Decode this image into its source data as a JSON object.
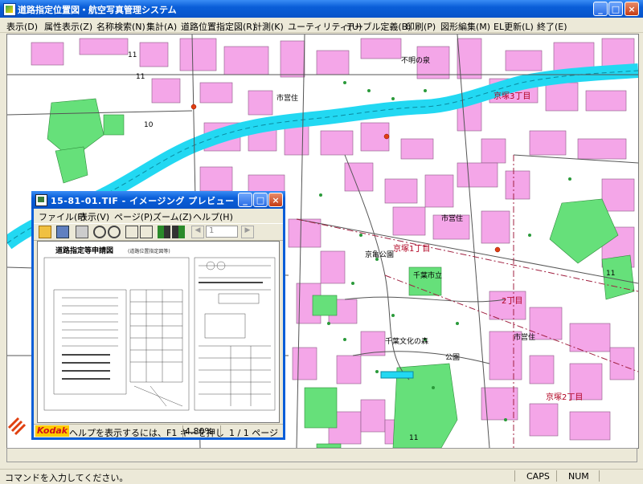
{
  "app": {
    "title": "道路指定位置図・航空写真管理システム",
    "window_buttons": {
      "minimize": "_",
      "maximize": "□",
      "close": "×"
    }
  },
  "menubar": [
    "表示(D)",
    "属性表示(Z)",
    "名称検索(N)",
    "集計(A)",
    "道路位置指定図(R)",
    "計測(K)",
    "ユーティリティ(U)",
    "テーブル定義(B)",
    "印刷(P)",
    "図形編集(M)",
    "EL更新(L)",
    "終了(E)"
  ],
  "map": {
    "labels": {
      "shiei1": "市営住",
      "shiei2": "市営住",
      "shiei3": "市営住",
      "kyouto": "京亀公園",
      "chiba_shiritsu": "千葉市立",
      "chiba_shiritsu2": "千葉文化の森",
      "kamimachi": "京塚1丁目",
      "kamimachi2": "京塚2丁目",
      "kamimachi3": "京塚3丁目",
      "machi2": "2丁目",
      "num_11a": "11",
      "num_11b": "11",
      "num_11c": "11",
      "num_11d": "11",
      "num_10": "10",
      "hoshi": "不明の泉",
      "kouen": "公園"
    },
    "colors": {
      "building": "#f4a6e8",
      "park": "#66e07a",
      "river": "#22d8f2",
      "road": "#7a7a7a"
    }
  },
  "child_window": {
    "title": "15-81-01.TIF - イメージング プレビュー",
    "menus": [
      "ファイル(F)",
      "表示(V)",
      "ページ(P)",
      "ズーム(Z)",
      "ヘルプ(H)"
    ],
    "page_field": "1",
    "document": {
      "heading": "道路指定等申請図",
      "subheading": "(道路位置指定図等)"
    },
    "status": {
      "brand": "Kodak",
      "help": "ヘルプを表示するには、F1 キーを押し",
      "zoom": "4.80%",
      "page": "1 / 1 ページ"
    }
  },
  "command_prompt": "コマンドを入力してください。",
  "status_indicators": {
    "caps": "CAPS",
    "num": "NUM"
  }
}
